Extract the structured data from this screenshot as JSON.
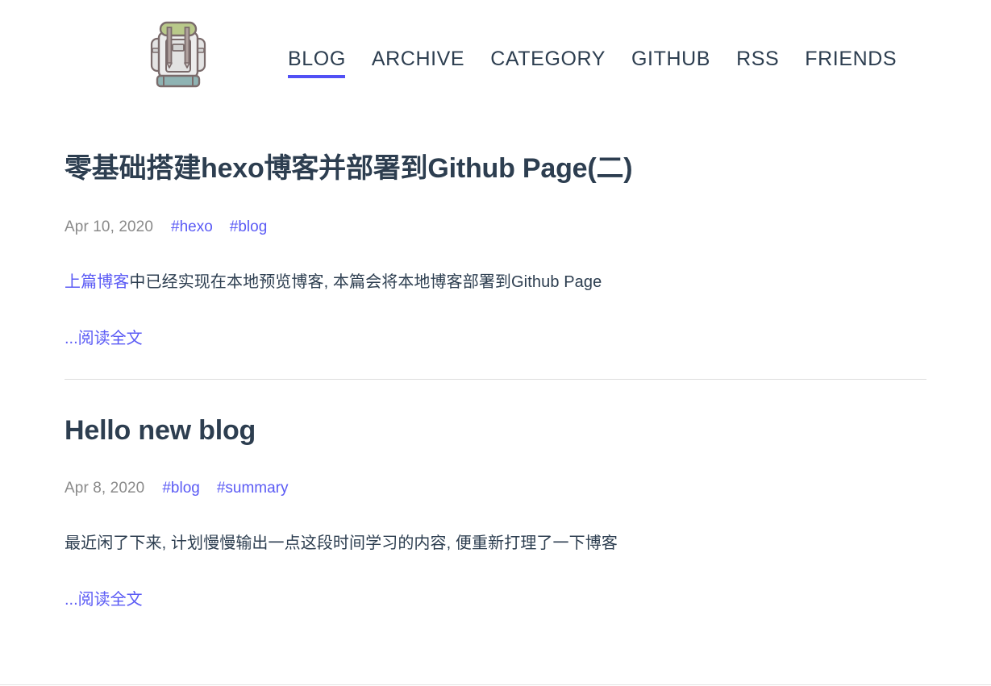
{
  "site": {
    "logo": {
      "icon": "backpack-icon",
      "colors": {
        "top_flap": "#b9c98a",
        "body": "#e8e8e8",
        "body_shade": "#dcdcdc",
        "outline": "#7a6b6b",
        "strap": "#9b8d8a",
        "base": "#8fb3b3",
        "pocket": "#e0e0e0"
      }
    },
    "accent_color": "#5150f5",
    "link_color": "#5b5bf5",
    "text_color": "#2d3e50",
    "muted_color": "#8a8a8a",
    "divider_color": "#dddddd",
    "background": "#ffffff"
  },
  "nav": {
    "items": [
      {
        "label": "BLOG",
        "active": true
      },
      {
        "label": "ARCHIVE",
        "active": false
      },
      {
        "label": "CATEGORY",
        "active": false
      },
      {
        "label": "GITHUB",
        "active": false
      },
      {
        "label": "RSS",
        "active": false
      },
      {
        "label": "FRIENDS",
        "active": false
      }
    ]
  },
  "posts": [
    {
      "title": "零基础搭建hexo博客并部署到Github Page(二)",
      "date": "Apr 10, 2020",
      "tags": [
        "#hexo",
        "#blog"
      ],
      "excerpt_link_text": "上篇博客",
      "excerpt_rest": "中已经实现在本地预览博客, 本篇会将本地博客部署到Github Page",
      "read_more": "...阅读全文",
      "has_divider": true
    },
    {
      "title": "Hello new blog",
      "date": "Apr 8, 2020",
      "tags": [
        "#blog",
        "#summary"
      ],
      "excerpt_link_text": "",
      "excerpt_rest": "最近闲了下来, 计划慢慢输出一点这段时间学习的内容, 便重新打理了一下博客",
      "read_more": "...阅读全文",
      "has_divider": false
    }
  ]
}
